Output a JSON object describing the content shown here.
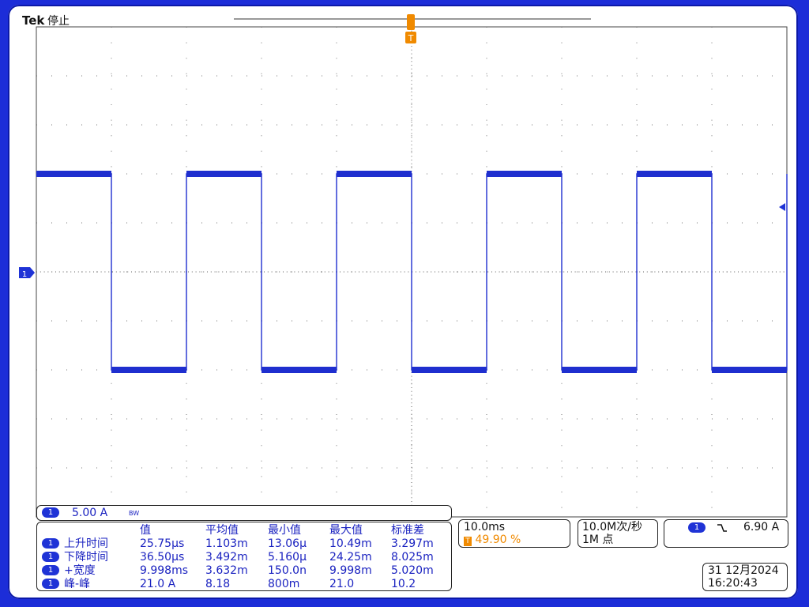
{
  "header": {
    "brand": "Tek",
    "status": "停止"
  },
  "trigger": {
    "marker_top": "T",
    "marker_label": "T"
  },
  "channel": {
    "marker": "1",
    "scale": "5.00 A",
    "bw_icon": "BW"
  },
  "measurements": {
    "columns": [
      "值",
      "平均值",
      "最小值",
      "最大值",
      "标准差"
    ],
    "rows": [
      {
        "ch": "1",
        "name": "上升时间",
        "values": [
          "25.75µs",
          "1.103m",
          "13.06µ",
          "10.49m",
          "3.297m"
        ]
      },
      {
        "ch": "1",
        "name": "下降时间",
        "values": [
          "36.50µs",
          "3.492m",
          "5.160µ",
          "24.25m",
          "8.025m"
        ]
      },
      {
        "ch": "1",
        "name": "+宽度",
        "values": [
          "9.998ms",
          "3.632m",
          "150.0n",
          "9.998m",
          "5.020m"
        ]
      },
      {
        "ch": "1",
        "name": "峰-峰",
        "values": [
          "21.0 A",
          "8.18",
          "800m",
          "21.0",
          "10.2"
        ]
      }
    ]
  },
  "timebase": {
    "per_div": "10.0ms",
    "trigger_pos_marker": "T",
    "trigger_pos": "49.90 %"
  },
  "acquisition": {
    "rate": "10.0M次/秒",
    "record": "1M 点"
  },
  "trigger_settings": {
    "ch": "1",
    "slope_icon": "falling-edge-icon",
    "level": "6.90 A"
  },
  "datetime": {
    "date": "31 12月2024",
    "time": "16:20:43"
  },
  "colors": {
    "trace": "#1f2fcf",
    "text": "#1a22c0",
    "trigger": "#f08a00",
    "background": "#ffffff",
    "border": "#1c2dd8"
  },
  "waveform": {
    "type": "square",
    "high_level_div": 2.0,
    "low_level_div": -2.0,
    "period_div": 2.0,
    "first_fall_div": 1.0,
    "duty_percent": 50
  }
}
